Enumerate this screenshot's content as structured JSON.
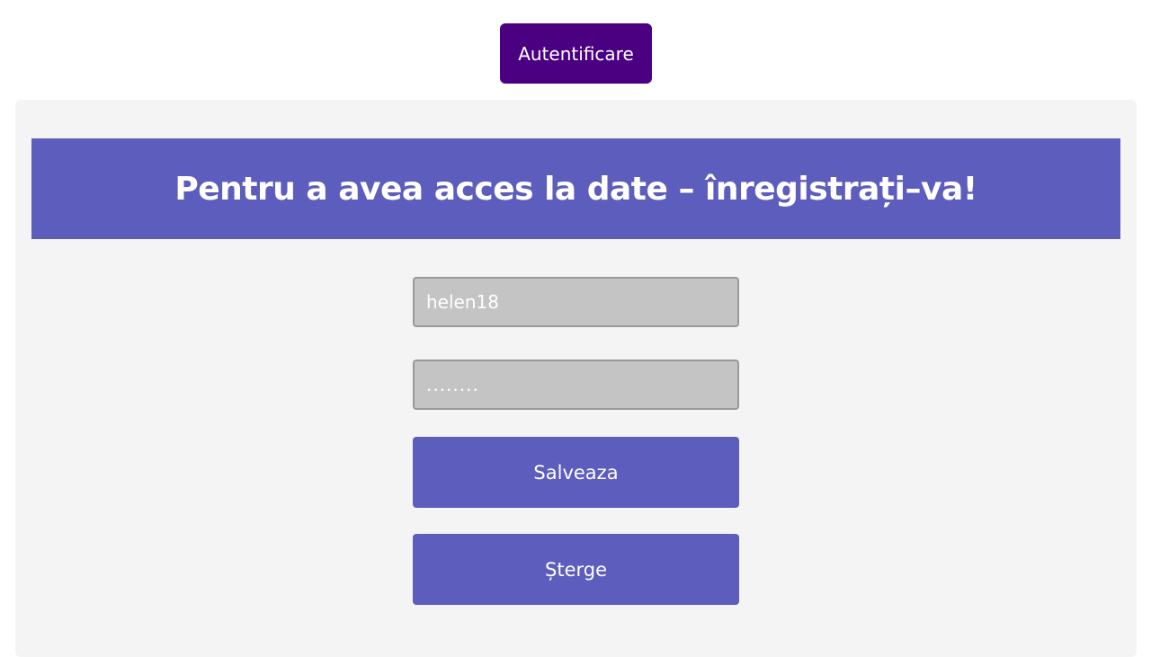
{
  "header": {
    "auth_button_label": "Autentificare"
  },
  "banner": {
    "title": "Pentru a avea acces la date – înregistrați–va!"
  },
  "form": {
    "username_value": "helen18",
    "password_value": "........",
    "save_label": "Salveaza",
    "delete_label": "Șterge"
  },
  "colors": {
    "auth_button": "#4b0082",
    "accent": "#5d5dbd",
    "panel_background": "#f4f4f4",
    "input_background": "#c4c4c4"
  }
}
